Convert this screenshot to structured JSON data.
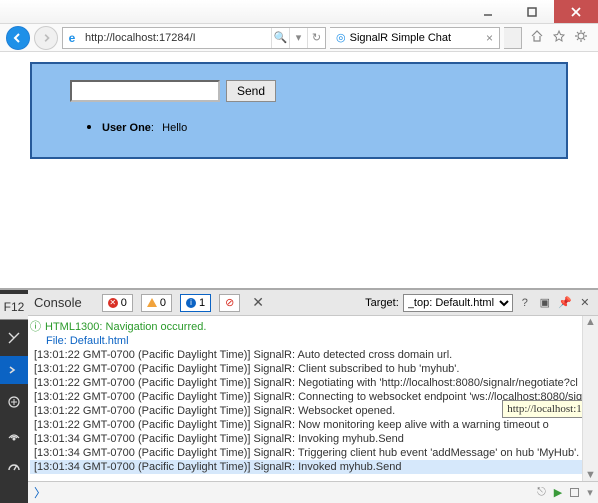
{
  "window": {
    "address": "http://localhost:17284/I",
    "tab_title": "SignalR Simple Chat"
  },
  "page": {
    "send_label": "Send",
    "message_input_value": "",
    "messages": [
      {
        "user": "User One",
        "text": "Hello"
      }
    ]
  },
  "devtools": {
    "f12_label": "F12",
    "panel_title": "Console",
    "errors": "0",
    "warnings": "0",
    "info": "1",
    "target_label": "Target:",
    "target_value": "_top: Default.html",
    "help": "?",
    "nav_line": "HTML1300: Navigation occurred.",
    "file_line": "File: Default.html",
    "tooltip": "http://localhost:1",
    "log": [
      "[13:01:22 GMT-0700 (Pacific Daylight Time)] SignalR: Auto detected cross domain url.",
      "[13:01:22 GMT-0700 (Pacific Daylight Time)] SignalR: Client subscribed to hub 'myhub'.",
      "[13:01:22 GMT-0700 (Pacific Daylight Time)] SignalR: Negotiating with 'http://localhost:8080/signalr/negotiate?cl",
      "[13:01:22 GMT-0700 (Pacific Daylight Time)] SignalR: Connecting to websocket endpoint 'ws://localhost:8080/signal",
      "[13:01:22 GMT-0700 (Pacific Daylight Time)] SignalR: Websocket opened.",
      "[13:01:22 GMT-0700 (Pacific Daylight Time)] SignalR: Now monitoring keep alive with a warning timeout o",
      "[13:01:34 GMT-0700 (Pacific Daylight Time)] SignalR: Invoking myhub.Send",
      "[13:01:34 GMT-0700 (Pacific Daylight Time)] SignalR: Triggering client hub event 'addMessage' on hub 'MyHub'.",
      "[13:01:34 GMT-0700 (Pacific Daylight Time)] SignalR: Invoked myhub.Send"
    ]
  }
}
